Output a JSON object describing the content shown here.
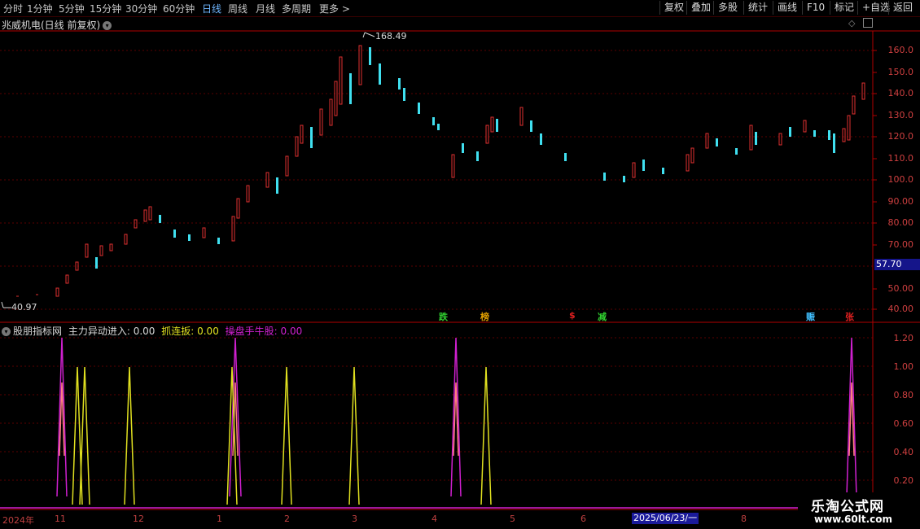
{
  "toolbar": {
    "periods": [
      "分时",
      "1分钟",
      "5分钟",
      "15分钟",
      "30分钟",
      "60分钟",
      "日线",
      "周线",
      "月线",
      "多周期",
      "更多"
    ],
    "more_arrow": ">",
    "right_buttons": [
      "复权",
      "叠加",
      "多股",
      "统计",
      "画线",
      "F10",
      "标记",
      "+自选",
      "返回"
    ]
  },
  "stock": {
    "title": "兆威机电(日线 前复权)",
    "high_label": "168.49",
    "low_label": "40.97",
    "current_price": "57.70"
  },
  "price_axis": [
    "160.0",
    "150.0",
    "140.0",
    "130.0",
    "120.0",
    "110.0",
    "100.0",
    "90.00",
    "80.00",
    "70.00",
    "50.00",
    "40.00"
  ],
  "signals": [
    {
      "text": "跌",
      "color": "#30d030"
    },
    {
      "text": "榜",
      "color": "#e0a000"
    },
    {
      "text": "$",
      "color": "#e02020"
    },
    {
      "text": "减",
      "color": "#30d030"
    },
    {
      "text": "赈",
      "color": "#40c0ff"
    },
    {
      "text": "张",
      "color": "#e02020"
    }
  ],
  "indicator": {
    "name": "股朋指标网",
    "items": [
      {
        "label": "主力异动进入: 0.00",
        "color": "#d8d8d8"
      },
      {
        "label": "抓连扳: 0.00",
        "color": "#e0e020"
      },
      {
        "label": "操盘手牛股: 0.00",
        "color": "#d020d0"
      }
    ],
    "axis": [
      "1.20",
      "1.00",
      "0.80",
      "0.60",
      "0.40",
      "0.20"
    ]
  },
  "date_axis": [
    "2024年",
    "11",
    "12",
    "1",
    "2",
    "3",
    "4",
    "5",
    "6",
    "8"
  ],
  "date_highlight": "2025/06/23/一",
  "watermark": {
    "title": "乐淘公式网",
    "url": "www.60lt.com"
  },
  "colors": {
    "up": "#e03030",
    "down": "#40e0f0",
    "grid": "#5a0000",
    "axis": "#b00000"
  }
}
